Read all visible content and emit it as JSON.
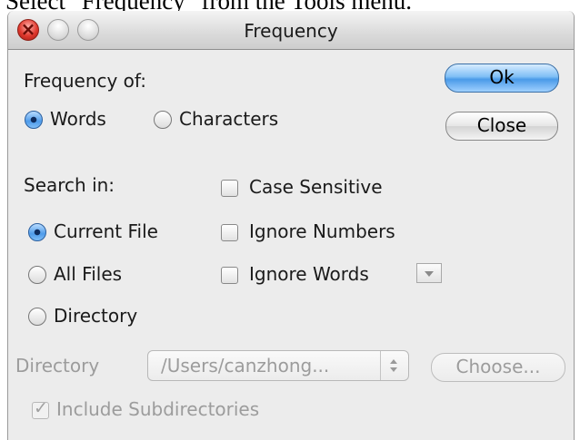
{
  "caption": "Select \"Frequency\" from the Tools menu.",
  "window": {
    "title": "Frequency"
  },
  "frequency_of": {
    "label": "Frequency of:",
    "options": [
      {
        "label": "Words",
        "selected": true
      },
      {
        "label": "Characters",
        "selected": false
      }
    ]
  },
  "buttons": {
    "ok": "Ok",
    "close": "Close",
    "choose": "Choose..."
  },
  "search_in": {
    "label": "Search in:",
    "options": [
      {
        "label": "Current File",
        "selected": true
      },
      {
        "label": "All Files",
        "selected": false
      },
      {
        "label": "Directory",
        "selected": false
      }
    ]
  },
  "checkboxes": [
    {
      "label": "Case Sensitive",
      "checked": false
    },
    {
      "label": "Ignore Numbers",
      "checked": false
    },
    {
      "label": "Ignore Words",
      "checked": false
    }
  ],
  "directory": {
    "label": "Directory",
    "value": "/Users/canzhong..."
  },
  "include_subdirectories": {
    "label": "Include Subdirectories",
    "checked": true,
    "enabled": false
  },
  "colors": {
    "accent": "#4a9ae8",
    "window_bg": "#ececec",
    "disabled_text": "#9c9c9c"
  }
}
